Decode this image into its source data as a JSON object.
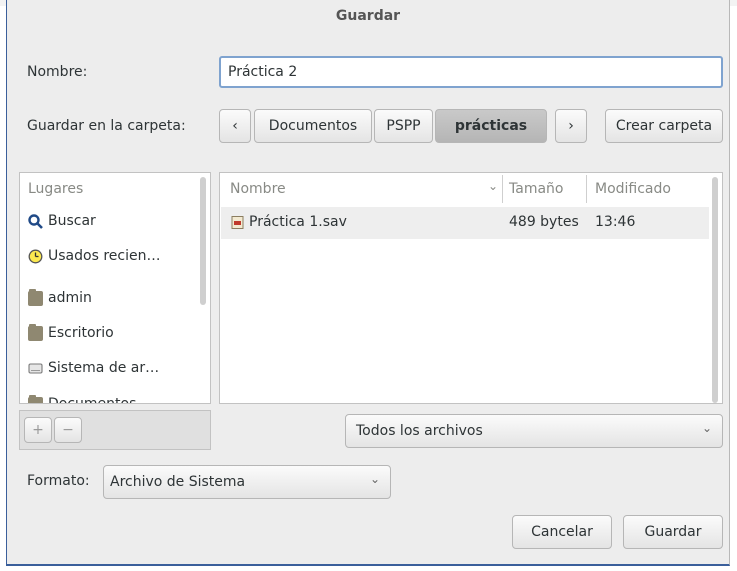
{
  "dialog": {
    "title": "Guardar",
    "name_label": "Nombre:",
    "name_value": "Práctica 2",
    "folder_label": "Guardar en la carpeta:",
    "path": [
      "Documentos",
      "PSPP",
      "prácticas"
    ],
    "create_folder": "Crear carpeta",
    "places_header": "Lugares",
    "places": [
      {
        "label": "Buscar",
        "icon": "search-icon"
      },
      {
        "label": "Usados recien…",
        "icon": "clock-icon"
      },
      {
        "label": "admin",
        "icon": "folder-icon"
      },
      {
        "label": "Escritorio",
        "icon": "folder-icon"
      },
      {
        "label": "Sistema de ar…",
        "icon": "drive-icon"
      },
      {
        "label": "Documentos",
        "icon": "folder-icon"
      }
    ],
    "columns": {
      "name": "Nombre",
      "size": "Tamaño",
      "modified": "Modificado"
    },
    "files": [
      {
        "name": "Práctica 1.sav",
        "size": "489 bytes",
        "modified": "13:46"
      }
    ],
    "filter": "Todos los archivos",
    "format_label": "Formato:",
    "format_value": "Archivo de Sistema",
    "cancel": "Cancelar",
    "save": "Guardar",
    "add_label": "+",
    "remove_label": "−"
  },
  "colors": {
    "accent": "#3a5f9b",
    "focus_ring": "#7fa3cf",
    "background": "#ededed"
  }
}
